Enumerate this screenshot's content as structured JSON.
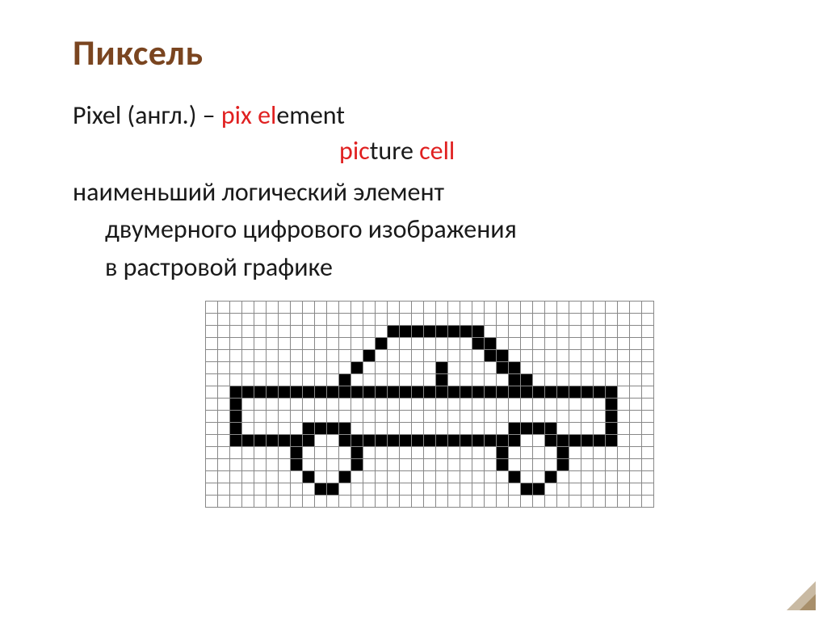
{
  "title": "Пиксель",
  "line1": {
    "prefix": "Pixel   (англ.) – ",
    "pix": "pix",
    "space1": " ",
    "el": "el",
    "ement": "ement"
  },
  "line2": {
    "pic": "pic",
    "ture": "ture ",
    "cell": "cell"
  },
  "definition": {
    "l1": "наименьший логический элемент",
    "l2": "двумерного цифрового изображения",
    "l3": "в растровой графике"
  },
  "pixel_art": {
    "cols": 37,
    "rows": 17,
    "grid": [
      "0000000000000000000000000000000000000",
      "0000000000000000000000000000000000000",
      "0000000000000001111111100000000000000",
      "0000000000000010000000110000000000000",
      "0000000000000100000000011000000000000",
      "0000000000001000000100001100000000000",
      "0000000000010000000100000110000000000",
      "0011111111111111111111111111111111000",
      "0010000000000000000000000000000001000",
      "0010000000000000000000000000000001000",
      "0010000011110000000000000111100001000",
      "0011111110011111111111111100111111000",
      "0000000100001000000000001000010000000",
      "0000000100001000000000001000010000000",
      "0000000010010000000000000100100000000",
      "0000000001100000000000000011000000000",
      "0000000000000000000000000000000000000"
    ]
  }
}
